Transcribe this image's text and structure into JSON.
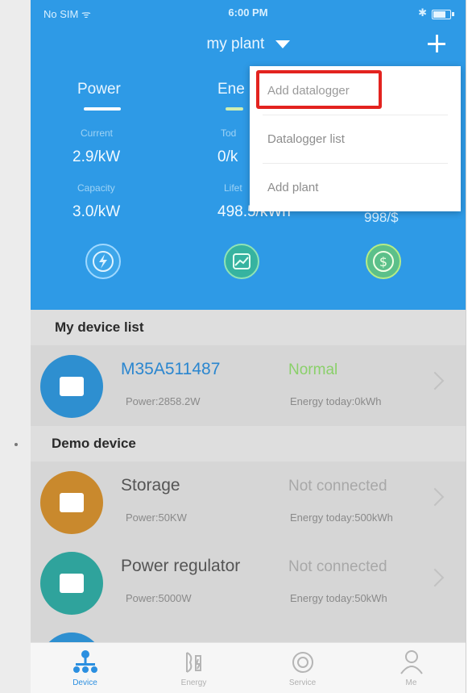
{
  "status_bar": {
    "carrier": "No SIM ᯤ",
    "time": "6:00 PM",
    "bluetooth": "✱"
  },
  "header": {
    "plant_name": "my plant"
  },
  "tabs": {
    "power": "Power",
    "energy": "Ene"
  },
  "stats": {
    "current_label": "Current",
    "current_value": "2.9/kW",
    "today_label": "Tod",
    "today_value": "0/k",
    "capacity_label": "Capacity",
    "capacity_value": "3.0/kW",
    "lifetime_label": "Lifet",
    "lifetime_value": "498.5/kWh",
    "right_value": "998/$"
  },
  "menu": {
    "items": [
      "Add datalogger",
      "Datalogger list",
      "Add plant"
    ]
  },
  "sections": {
    "my_devices": "My device list",
    "demo": "Demo device"
  },
  "devices": [
    {
      "name": "M35A511487",
      "status": "Normal",
      "power": "Power:2858.2W",
      "energy": "Energy today:0kWh",
      "color": "#2e8fd0",
      "status_color": "#8ad06a",
      "name_color": "#2a86cf"
    },
    {
      "name": "Storage",
      "status": "Not connected",
      "power": "Power:50KW",
      "energy": "Energy today:500kWh",
      "color": "#c9892d",
      "status_color": "#a8a8a8",
      "name_color": "#555555"
    },
    {
      "name": "Power regulator",
      "status": "Not connected",
      "power": "Power:5000W",
      "energy": "Energy today:50kWh",
      "color": "#2fa39c",
      "status_color": "#a8a8a8",
      "name_color": "#555555"
    }
  ],
  "nav": {
    "device": "Device",
    "energy": "Energy",
    "service": "Service",
    "me": "Me"
  },
  "colors": {
    "header_blue": "#2e9ae6",
    "highlight_red": "#e3231f",
    "active_nav": "#2b8fe0"
  }
}
